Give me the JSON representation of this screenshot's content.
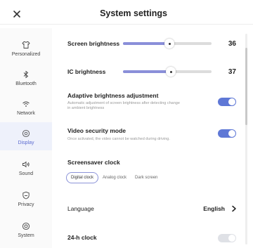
{
  "header": {
    "title": "System settings",
    "close_icon": "close-icon"
  },
  "sidebar": {
    "items": [
      {
        "label": "Personalized",
        "icon": "shirt-icon",
        "active": false
      },
      {
        "label": "Bluetooth",
        "icon": "bluetooth-icon",
        "active": false
      },
      {
        "label": "Network",
        "icon": "wifi-icon",
        "active": false
      },
      {
        "label": "Display",
        "icon": "display-icon",
        "active": true
      },
      {
        "label": "Sound",
        "icon": "speaker-icon",
        "active": false
      },
      {
        "label": "Privacy",
        "icon": "shield-icon",
        "active": false
      },
      {
        "label": "System",
        "icon": "system-icon",
        "active": false
      }
    ]
  },
  "settings": {
    "screen_brightness": {
      "label": "Screen brightness",
      "value": "36",
      "level": 0.36
    },
    "ic_brightness": {
      "label": "IC brightness",
      "value": "37",
      "level": 0.37
    },
    "adaptive": {
      "label": "Adaptive brightness adjustment",
      "desc": "Automatic adjustment of screen brightness after detecting change in ambient brightness",
      "on": true
    },
    "video_security": {
      "label": "Video security mode",
      "desc": "Once activated, the video cannot be watched during driving.",
      "on": true
    },
    "screensaver": {
      "label": "Screensaver clock",
      "options": [
        "Digital clock",
        "Analog clock",
        "Dark screen"
      ],
      "selected": "Digital clock"
    },
    "language": {
      "label": "Language",
      "value": "English"
    },
    "clock24": {
      "label": "24-h clock",
      "on": false
    }
  },
  "colors": {
    "accent": "#5f78d6",
    "slider_fill": "#8a8fd9",
    "active_bg": "#eef1fb"
  }
}
